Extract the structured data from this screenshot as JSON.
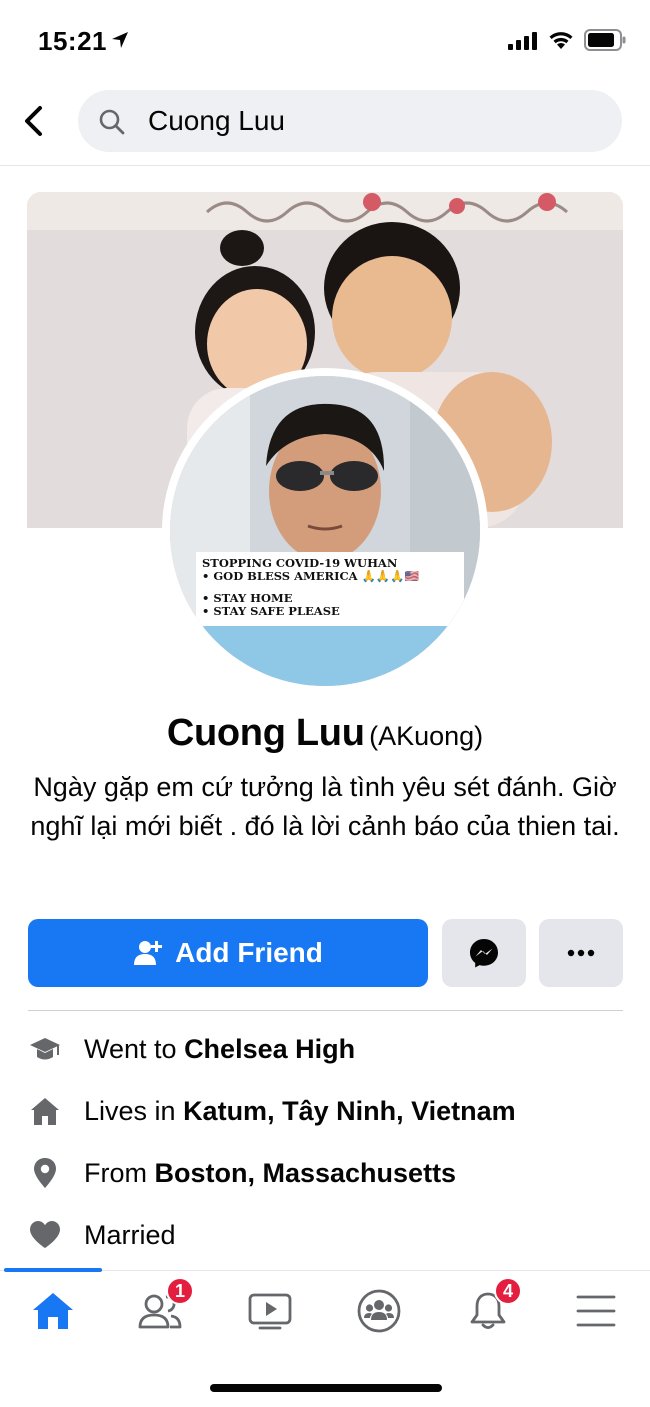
{
  "status_bar": {
    "time": "15:21"
  },
  "search": {
    "query": "Cuong Luu"
  },
  "profile": {
    "name": "Cuong Luu",
    "alternate_name": "(AKuong)",
    "bio": "Ngày gặp em cứ tưởng là tình yêu sét đánh. Giờ nghĩ lại mới biết . đó là lời cảnh báo của thien tai.",
    "avatar_banner": [
      "STOPPING COVID-19 WUHAN",
      "• GOD BLESS AMERICA 🙏🙏🙏🇺🇸",
      "• STAY HOME",
      "• STAY SAFE PLEASE"
    ]
  },
  "actions": {
    "add_friend_label": "Add Friend"
  },
  "info": [
    {
      "icon": "graduation-cap-icon",
      "prefix": "Went to ",
      "value": "Chelsea High"
    },
    {
      "icon": "house-icon",
      "prefix": "Lives in ",
      "value": "Katum, Tây Ninh, Vietnam"
    },
    {
      "icon": "location-pin-icon",
      "prefix": "From ",
      "value": "Boston, Massachusetts"
    },
    {
      "icon": "heart-icon",
      "prefix": "",
      "value": "Married"
    }
  ],
  "tab_bar": {
    "tabs": [
      {
        "name": "home",
        "icon": "home-icon",
        "active": true
      },
      {
        "name": "friends",
        "icon": "friends-icon",
        "badge": "1"
      },
      {
        "name": "watch",
        "icon": "video-icon"
      },
      {
        "name": "groups",
        "icon": "groups-icon"
      },
      {
        "name": "notifications",
        "icon": "bell-icon",
        "badge": "4"
      },
      {
        "name": "menu",
        "icon": "menu-icon"
      }
    ]
  },
  "colors": {
    "accent": "#1877f2",
    "badge": "#e41e3f",
    "button_secondary": "#e4e6eb"
  }
}
